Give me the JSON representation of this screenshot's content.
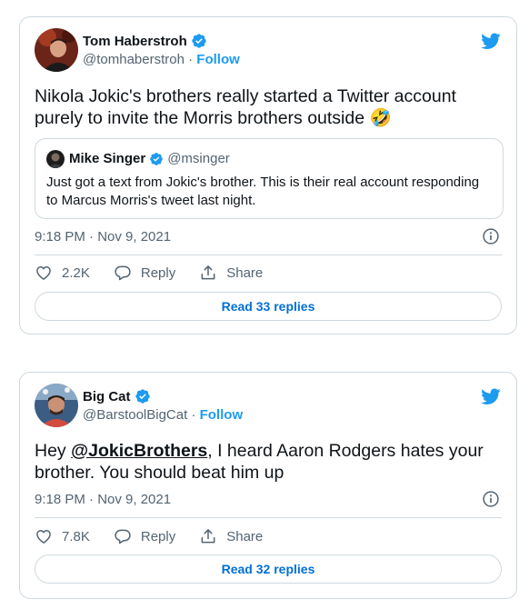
{
  "tweets": [
    {
      "name": "Tom Haberstroh",
      "handle": "@tomhaberstroh",
      "separator": "·",
      "follow": "Follow",
      "text": "Nikola Jokic's brothers really started a Twitter account purely to invite the Morris brothers outside",
      "emoji": "🤣",
      "quote": {
        "name": "Mike Singer",
        "handle": "@msinger",
        "text": "Just got a text from Jokic's brother. This is their real account responding to Marcus Morris's tweet last night."
      },
      "timestamp": "9:18 PM · Nov 9, 2021",
      "likes": "2.2K",
      "reply_label": "Reply",
      "share_label": "Share",
      "read_replies": "Read 33 replies"
    },
    {
      "name": "Big Cat",
      "handle": "@BarstoolBigCat",
      "separator": "·",
      "follow": "Follow",
      "text_prefix": "Hey ",
      "mention": "@JokicBrothers",
      "text_suffix": ", I heard Aaron Rodgers hates your brother. You should beat him up",
      "timestamp": "9:18 PM · Nov 9, 2021",
      "likes": "7.8K",
      "reply_label": "Reply",
      "share_label": "Share",
      "read_replies": "Read 32 replies"
    }
  ],
  "colors": {
    "twitter_blue": "#1d9bf0",
    "link_blue": "#006fd6",
    "secondary_text": "#536471",
    "border": "#cfd9de"
  },
  "icons": [
    "verified-badge-icon",
    "twitter-bird-icon",
    "info-icon",
    "heart-icon",
    "reply-icon",
    "share-icon"
  ]
}
